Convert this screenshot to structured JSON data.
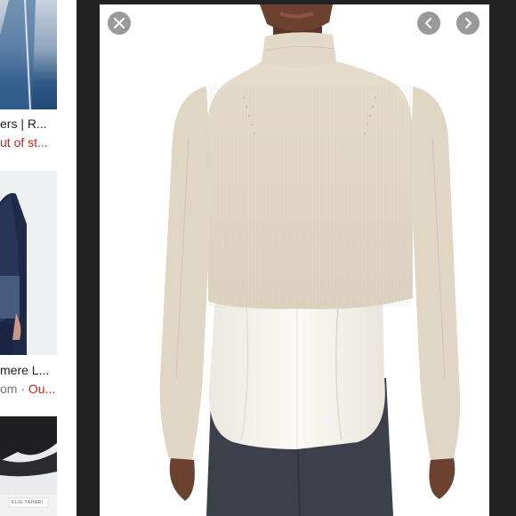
{
  "results": [
    {
      "title": "ers | R...",
      "source": "ut of st..."
    },
    {
      "title": "mere L...",
      "source": "om · ",
      "source_red": "Ou..."
    },
    {
      "thumb_label": "ELIE TAHARI"
    }
  ],
  "viewer": {
    "close_icon": "close-icon",
    "prev_icon": "chevron-left-icon",
    "next_icon": "chevron-right-icon"
  },
  "colors": {
    "viewer_bg": "#222222",
    "sweater": "#e2d8c7",
    "blouse": "#f4f1ea",
    "pants": "#3d3f4a",
    "link_red": "#c5221f"
  }
}
